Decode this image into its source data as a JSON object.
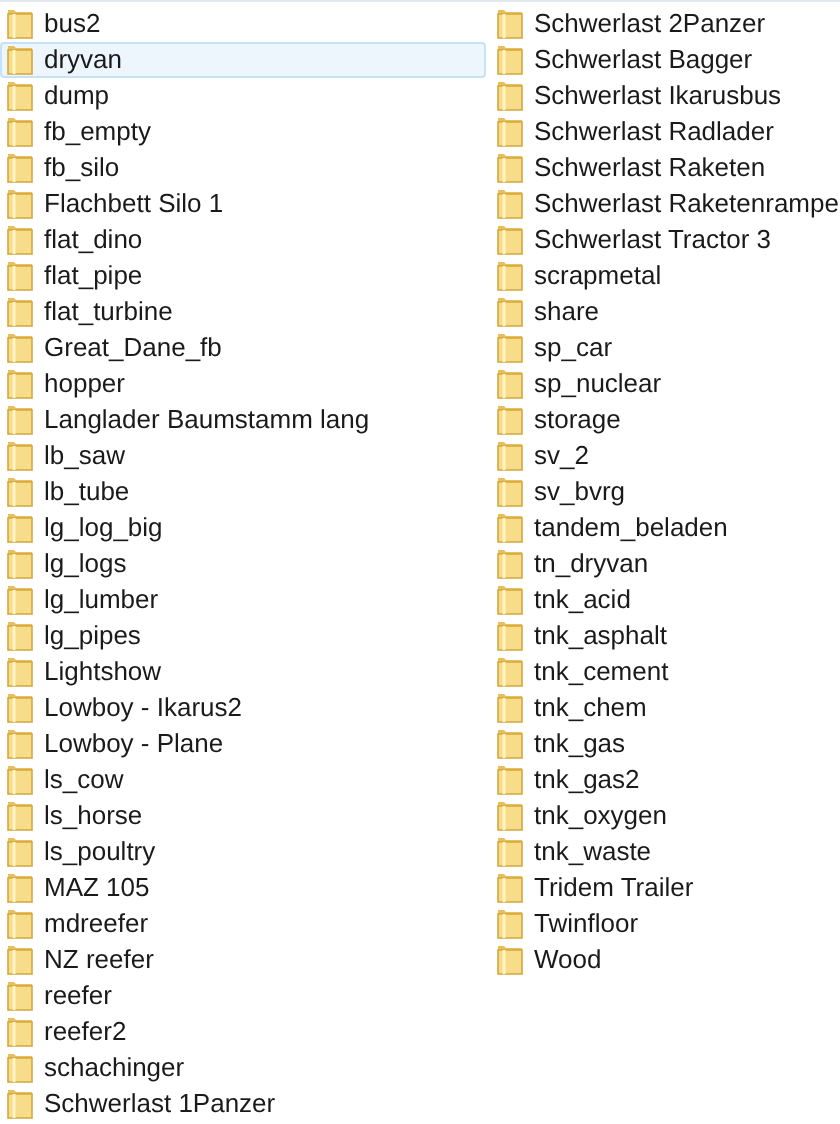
{
  "folders": [
    {
      "name": "bus2",
      "selected": false
    },
    {
      "name": "dryvan",
      "selected": true
    },
    {
      "name": "dump",
      "selected": false
    },
    {
      "name": "fb_empty",
      "selected": false
    },
    {
      "name": "fb_silo",
      "selected": false
    },
    {
      "name": "Flachbett Silo 1",
      "selected": false
    },
    {
      "name": "flat_dino",
      "selected": false
    },
    {
      "name": "flat_pipe",
      "selected": false
    },
    {
      "name": "flat_turbine",
      "selected": false
    },
    {
      "name": "Great_Dane_fb",
      "selected": false
    },
    {
      "name": "hopper",
      "selected": false
    },
    {
      "name": "Langlader Baumstamm lang",
      "selected": false
    },
    {
      "name": "lb_saw",
      "selected": false
    },
    {
      "name": "lb_tube",
      "selected": false
    },
    {
      "name": "lg_log_big",
      "selected": false
    },
    {
      "name": "lg_logs",
      "selected": false
    },
    {
      "name": "lg_lumber",
      "selected": false
    },
    {
      "name": "lg_pipes",
      "selected": false
    },
    {
      "name": "Lightshow",
      "selected": false
    },
    {
      "name": "Lowboy - Ikarus2",
      "selected": false
    },
    {
      "name": "Lowboy - Plane",
      "selected": false
    },
    {
      "name": "ls_cow",
      "selected": false
    },
    {
      "name": "ls_horse",
      "selected": false
    },
    {
      "name": "ls_poultry",
      "selected": false
    },
    {
      "name": "MAZ 105",
      "selected": false
    },
    {
      "name": "mdreefer",
      "selected": false
    },
    {
      "name": "NZ reefer",
      "selected": false
    },
    {
      "name": "reefer",
      "selected": false
    },
    {
      "name": "reefer2",
      "selected": false
    },
    {
      "name": "schachinger",
      "selected": false
    },
    {
      "name": "Schwerlast 1Panzer",
      "selected": false
    },
    {
      "name": "Schwerlast 2Panzer",
      "selected": false
    },
    {
      "name": "Schwerlast Bagger",
      "selected": false
    },
    {
      "name": "Schwerlast Ikarusbus",
      "selected": false
    },
    {
      "name": "Schwerlast Radlader",
      "selected": false
    },
    {
      "name": "Schwerlast Raketen",
      "selected": false
    },
    {
      "name": "Schwerlast Raketenrampe",
      "selected": false
    },
    {
      "name": "Schwerlast Tractor 3",
      "selected": false
    },
    {
      "name": "scrapmetal",
      "selected": false
    },
    {
      "name": "share",
      "selected": false
    },
    {
      "name": "sp_car",
      "selected": false
    },
    {
      "name": "sp_nuclear",
      "selected": false
    },
    {
      "name": "storage",
      "selected": false
    },
    {
      "name": "sv_2",
      "selected": false
    },
    {
      "name": "sv_bvrg",
      "selected": false
    },
    {
      "name": "tandem_beladen",
      "selected": false
    },
    {
      "name": "tn_dryvan",
      "selected": false
    },
    {
      "name": "tnk_acid",
      "selected": false
    },
    {
      "name": "tnk_asphalt",
      "selected": false
    },
    {
      "name": "tnk_cement",
      "selected": false
    },
    {
      "name": "tnk_chem",
      "selected": false
    },
    {
      "name": "tnk_gas",
      "selected": false
    },
    {
      "name": "tnk_gas2",
      "selected": false
    },
    {
      "name": "tnk_oxygen",
      "selected": false
    },
    {
      "name": "tnk_waste",
      "selected": false
    },
    {
      "name": "Tridem Trailer",
      "selected": false
    },
    {
      "name": "Twinfloor",
      "selected": false
    },
    {
      "name": "Wood",
      "selected": false
    }
  ]
}
